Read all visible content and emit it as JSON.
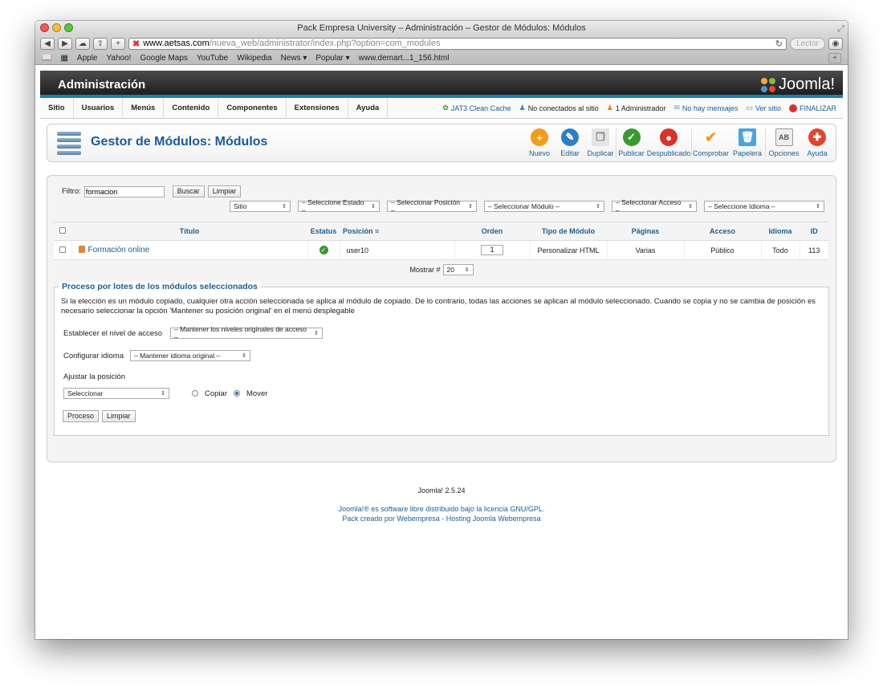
{
  "browser": {
    "window_title": "Pack Empresa University – Administración – Gestor de Módulos: Módulos",
    "url_host": "www.aetsas.com",
    "url_path": "/nueva_web/administrator/index.php?option=com_modules",
    "reader_label": "Lector",
    "bookmarks": [
      "Apple",
      "Yahoo!",
      "Google Maps",
      "YouTube",
      "Wikipedia",
      "News ▾",
      "Popular ▾",
      "www.demart...1_156.html"
    ]
  },
  "admin": {
    "title": "Administración",
    "logo_text": "Joomla!"
  },
  "menu": {
    "items": [
      "Sitio",
      "Usuarios",
      "Menús",
      "Contenido",
      "Componentes",
      "Extensiones",
      "Ayuda"
    ]
  },
  "status": {
    "cache": "JAT3 Clean Cache",
    "not_connected": "No conectados al sitio",
    "admins": "1 Administrador",
    "messages": "No hay mensajes",
    "view_site": "Ver sitio",
    "logout": "FINALIZAR"
  },
  "header": {
    "title": "Gestor de Módulos: Módulos",
    "actions": [
      {
        "label": "Nuevo",
        "color": "#f39c1c",
        "icon": "plus-icon"
      },
      {
        "label": "Editar",
        "color": "#2f7fc4",
        "icon": "edit-icon"
      },
      {
        "label": "Duplicar",
        "color": "#cfcfcf",
        "icon": "copy-icon"
      },
      {
        "label": "Publicar",
        "color": "#3a9a2e",
        "icon": "publish-icon"
      },
      {
        "label": "Despublicado",
        "color": "#d9322b",
        "icon": "unpublish-icon"
      },
      {
        "label": "Comprobar",
        "color": "#f39c1c",
        "icon": "checkin-icon"
      },
      {
        "label": "Papelera",
        "color": "#4aa3dd",
        "icon": "trash-icon"
      },
      {
        "label": "Opciones",
        "color": "#999999",
        "icon": "options-icon"
      },
      {
        "label": "Ayuda",
        "color": "#e2452f",
        "icon": "help-icon"
      }
    ]
  },
  "filter": {
    "label": "Filtro:",
    "value": "formacion",
    "search_button": "Buscar",
    "clear_button": "Limpiar",
    "selects": [
      "Sitio",
      "– Seleccione Estado –",
      "– Seleccionar Posición –",
      "– Seleccionar Módulo –",
      "– Seleccionar Acceso –",
      "– Seleccione Idioma –"
    ]
  },
  "table": {
    "headers": {
      "title": "Título",
      "status": "Estatus",
      "position": "Posición",
      "order": "Orden",
      "type": "Tipo de Módulo",
      "pages": "Páginas",
      "access": "Acceso",
      "language": "Idioma",
      "id": "ID"
    },
    "rows": [
      {
        "title": "Formación online",
        "position": "user10",
        "order": "1",
        "type": "Personalizar HTML",
        "pages": "Varias",
        "access": "Público",
        "language": "Todo",
        "id": "113"
      }
    ]
  },
  "pager": {
    "label": "Mostrar #",
    "value": "20"
  },
  "batch": {
    "legend": "Proceso por lotes de los módulos seleccionados",
    "description": "Si la elección es un módulo copiado, cualquier otra acción seleccionada se aplica al módulo de copiado. De lo contrario, todas las acciones se aplican al módulo seleccionado. Cuando se copia y no se cambia de posición es necesario seleccionar la opción 'Mantener su posición original' en el menú desplegable",
    "access_label": "Establecer el nivel de acceso",
    "access_value": "– Mantener los niveles originales de acceso –",
    "language_label": "Configurar idioma",
    "language_value": "– Mantener idioma original –",
    "position_label": "Ajustar la posición",
    "position_value": "Seleccionar",
    "copy_label": "Copiar",
    "move_label": "Mover",
    "process_button": "Proceso",
    "clear_button": "Limpiar"
  },
  "footer": {
    "version": "Joomla! 2.5.24",
    "license": "Joomla!® es software libre distribuido bajo la licencia GNU/GPL.",
    "credit": "Pack creado por Webempresa - Hosting Joomla Webempresa"
  }
}
